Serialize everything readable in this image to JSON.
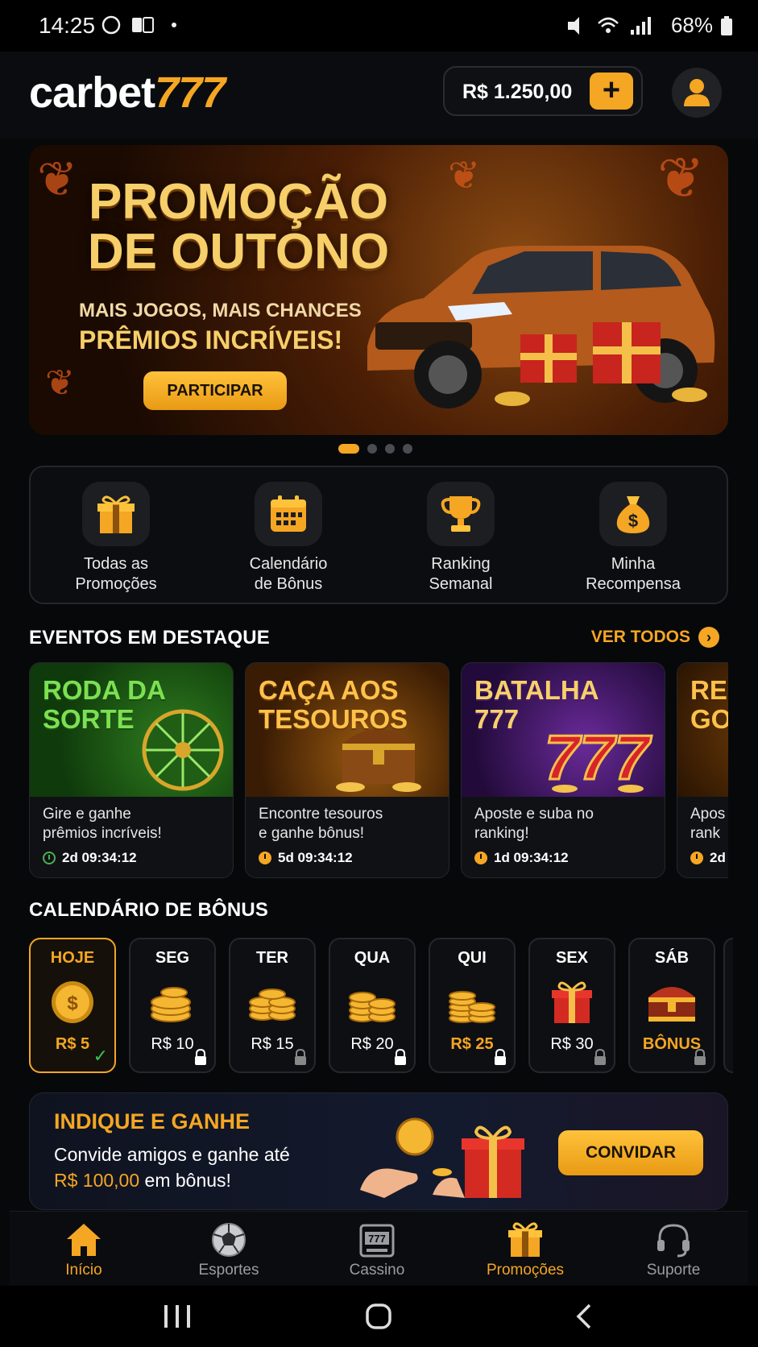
{
  "status_bar": {
    "time": "14:25",
    "battery": "68%"
  },
  "header": {
    "logo_main": "carbet",
    "logo_num": "777",
    "balance": "R$ 1.250,00",
    "add_label": "+"
  },
  "banner": {
    "title_line1": "PROMOÇÃO",
    "title_line2": "DE OUTONO",
    "subtitle1": "MAIS JOGOS, MAIS CHANCES",
    "subtitle2": "PRÊMIOS INCRÍVEIS!",
    "cta": "PARTICIPAR",
    "slides": 4,
    "active_slide": 1
  },
  "quick_links": [
    {
      "label1": "Todas as",
      "label2": "Promoções",
      "icon": "gift-icon"
    },
    {
      "label1": "Calendário",
      "label2": "de Bônus",
      "icon": "calendar-icon"
    },
    {
      "label1": "Ranking",
      "label2": "Semanal",
      "icon": "trophy-icon"
    },
    {
      "label1": "Minha",
      "label2": "Recompensa",
      "icon": "money-bag-icon"
    }
  ],
  "events": {
    "title": "EVENTOS EM DESTAQUE",
    "see_all": "VER TODOS",
    "cards": [
      {
        "t1": "RODA DA",
        "t2": "SORTE",
        "desc1": "Gire e ganhe",
        "desc2": "prêmios incríveis!",
        "timer": "2d 09:34:12"
      },
      {
        "t1": "CAÇA AOS",
        "t2": "TESOUROS",
        "desc1": "Encontre tesouros",
        "desc2": "e ganhe bônus!",
        "timer": "5d 09:34:12"
      },
      {
        "t1": "BATALHA",
        "t2": "777",
        "desc1": "Aposte e suba no",
        "desc2": "ranking!",
        "timer": "1d 09:34:12"
      },
      {
        "t1": "RE",
        "t2": "GO",
        "desc1": "Apos",
        "desc2": "rank",
        "timer": "2d"
      }
    ]
  },
  "calendar": {
    "title": "CALENDÁRIO DE BÔNUS",
    "days": [
      {
        "name": "HOJE",
        "value": "R$ 5"
      },
      {
        "name": "SEG",
        "value": "R$ 10"
      },
      {
        "name": "TER",
        "value": "R$ 15"
      },
      {
        "name": "QUA",
        "value": "R$ 20"
      },
      {
        "name": "QUI",
        "value": "R$ 25"
      },
      {
        "name": "SEX",
        "value": "R$ 30"
      },
      {
        "name": "SÁB",
        "value": "BÔNUS"
      }
    ]
  },
  "invite": {
    "title": "INDIQUE E GANHE",
    "text1": "Convide amigos e ganhe até",
    "amount": "R$ 100,00",
    "text2": " em bônus!",
    "button": "CONVIDAR"
  },
  "bottom_nav": [
    {
      "label": "Início",
      "icon": "home-icon"
    },
    {
      "label": "Esportes",
      "icon": "soccer-ball-icon"
    },
    {
      "label": "Cassino",
      "icon": "slot-machine-icon"
    },
    {
      "label": "Promoções",
      "icon": "gift-icon"
    },
    {
      "label": "Suporte",
      "icon": "headset-icon"
    }
  ],
  "colors": {
    "accent": "#f5a623",
    "background": "#07080a",
    "success": "#35c25a"
  }
}
